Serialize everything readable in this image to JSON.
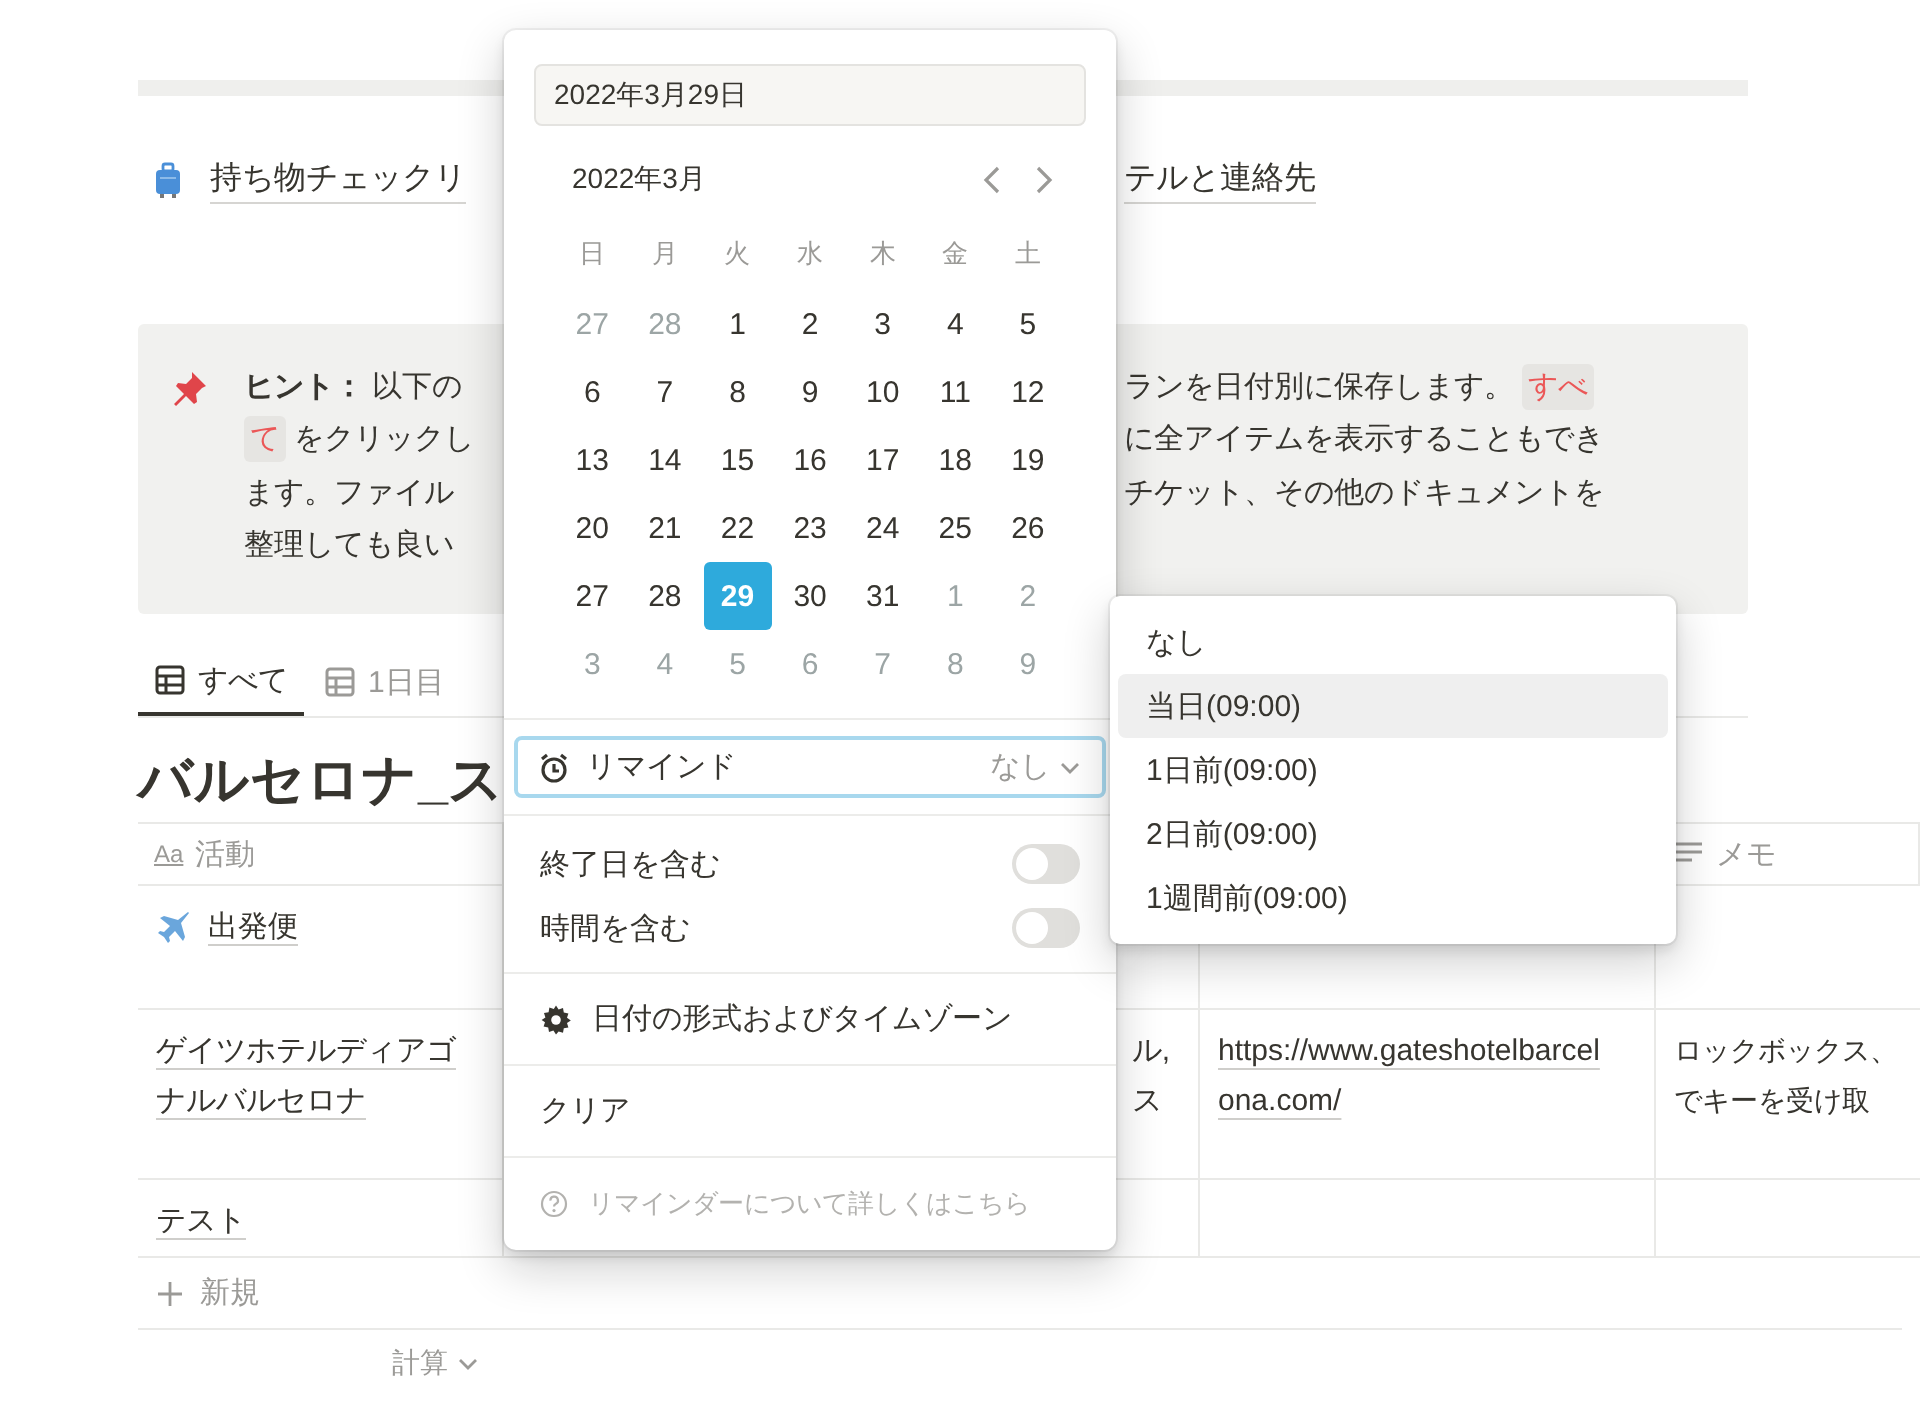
{
  "link_row": {
    "links": [
      "持ち物チェックリ",
      "テルと連絡先"
    ]
  },
  "callout": {
    "left_lines": [
      [
        {
          "kind": "text",
          "text": "**ヒント：** 以下の"
        }
      ],
      [
        {
          "kind": "code",
          "text": "て"
        },
        {
          "kind": "text",
          "text": "をクリックし"
        }
      ],
      [
        {
          "kind": "text",
          "text": "ます。ファイル"
        }
      ],
      [
        {
          "kind": "text",
          "text": "整理しても良い"
        }
      ]
    ],
    "right_lines": [
      [
        {
          "kind": "text",
          "text": "ランを日付別に保存します。"
        },
        {
          "kind": "code",
          "text": "すべ"
        }
      ],
      [
        {
          "kind": "text",
          "text": "に全アイテムを表示することもでき"
        }
      ],
      [
        {
          "kind": "text",
          "text": "チケット、その他のドキュメントを"
        }
      ]
    ]
  },
  "tabs": [
    {
      "label": "すべて",
      "selected": true
    },
    {
      "label": "1日目",
      "selected": false
    }
  ],
  "table": {
    "title": "バルセロナ_ス",
    "header": {
      "column_1": {
        "type_mark": "Aa",
        "label": "活動"
      },
      "column_4": {
        "label": "メモ"
      }
    },
    "rows": [
      {
        "column_1": "出発便",
        "icon": true
      },
      {
        "column_1": "ゲイツホテルディアゴナルバルセロナ",
        "icon": false,
        "column_2": "ル,\nス",
        "column_3": "https://www.gateshotelbarcel\nona.com/",
        "column_4": "ロックボックス、でキーを受け取"
      },
      {
        "column_1": "テスト",
        "icon": false
      }
    ],
    "new_row": "新規",
    "footer": "計算"
  },
  "date_picker": {
    "date_field": "2022年3月29日",
    "month": "2022年3月",
    "weekdays": [
      "日",
      "月",
      "火",
      "水",
      "木",
      "金",
      "土"
    ],
    "days": [
      {
        "day": "27",
        "outside": true,
        "selected": false
      },
      {
        "day": "28",
        "outside": true,
        "selected": false
      },
      {
        "day": "1",
        "outside": false,
        "selected": false
      },
      {
        "day": "2",
        "outside": false,
        "selected": false
      },
      {
        "day": "3",
        "outside": false,
        "selected": false
      },
      {
        "day": "4",
        "outside": false,
        "selected": false
      },
      {
        "day": "5",
        "outside": false,
        "selected": false
      },
      {
        "day": "6",
        "outside": false,
        "selected": false
      },
      {
        "day": "7",
        "outside": false,
        "selected": false
      },
      {
        "day": "8",
        "outside": false,
        "selected": false
      },
      {
        "day": "9",
        "outside": false,
        "selected": false
      },
      {
        "day": "10",
        "outside": false,
        "selected": false
      },
      {
        "day": "11",
        "outside": false,
        "selected": false
      },
      {
        "day": "12",
        "outside": false,
        "selected": false
      },
      {
        "day": "13",
        "outside": false,
        "selected": false
      },
      {
        "day": "14",
        "outside": false,
        "selected": false
      },
      {
        "day": "15",
        "outside": false,
        "selected": false
      },
      {
        "day": "16",
        "outside": false,
        "selected": false
      },
      {
        "day": "17",
        "outside": false,
        "selected": false
      },
      {
        "day": "18",
        "outside": false,
        "selected": false
      },
      {
        "day": "19",
        "outside": false,
        "selected": false
      },
      {
        "day": "20",
        "outside": false,
        "selected": false
      },
      {
        "day": "21",
        "outside": false,
        "selected": false
      },
      {
        "day": "22",
        "outside": false,
        "selected": false
      },
      {
        "day": "23",
        "outside": false,
        "selected": false
      },
      {
        "day": "24",
        "outside": false,
        "selected": false
      },
      {
        "day": "25",
        "outside": false,
        "selected": false
      },
      {
        "day": "26",
        "outside": false,
        "selected": false
      },
      {
        "day": "27",
        "outside": false,
        "selected": false
      },
      {
        "day": "28",
        "outside": false,
        "selected": false
      },
      {
        "day": "29",
        "outside": false,
        "selected": true
      },
      {
        "day": "30",
        "outside": false,
        "selected": false
      },
      {
        "day": "31",
        "outside": false,
        "selected": false
      },
      {
        "day": "1",
        "outside": true,
        "selected": false
      },
      {
        "day": "2",
        "outside": true,
        "selected": false
      },
      {
        "day": "3",
        "outside": true,
        "selected": false
      },
      {
        "day": "4",
        "outside": true,
        "selected": false
      },
      {
        "day": "5",
        "outside": true,
        "selected": false
      },
      {
        "day": "6",
        "outside": true,
        "selected": false
      },
      {
        "day": "7",
        "outside": true,
        "selected": false
      },
      {
        "day": "8",
        "outside": true,
        "selected": false
      },
      {
        "day": "9",
        "outside": true,
        "selected": false
      }
    ],
    "reminder": {
      "label": "リマインド",
      "value": "なし",
      "focused": true
    },
    "toggles": [
      {
        "label": "終了日を含む",
        "on": false
      },
      {
        "label": "時間を含む",
        "on": false
      }
    ],
    "format_label": "日付の形式およびタイムゾーン",
    "clear": "クリア",
    "help": "リマインダーについて詳しくはこちら"
  },
  "reminder_menu": {
    "options": [
      {
        "label": "なし",
        "selected": false
      },
      {
        "label": "当日(09:00)",
        "selected": true
      },
      {
        "label": "1日前(09:00)",
        "selected": false
      },
      {
        "label": "2日前(09:00)",
        "selected": false
      },
      {
        "label": "1週間前(09:00)",
        "selected": false
      }
    ]
  }
}
